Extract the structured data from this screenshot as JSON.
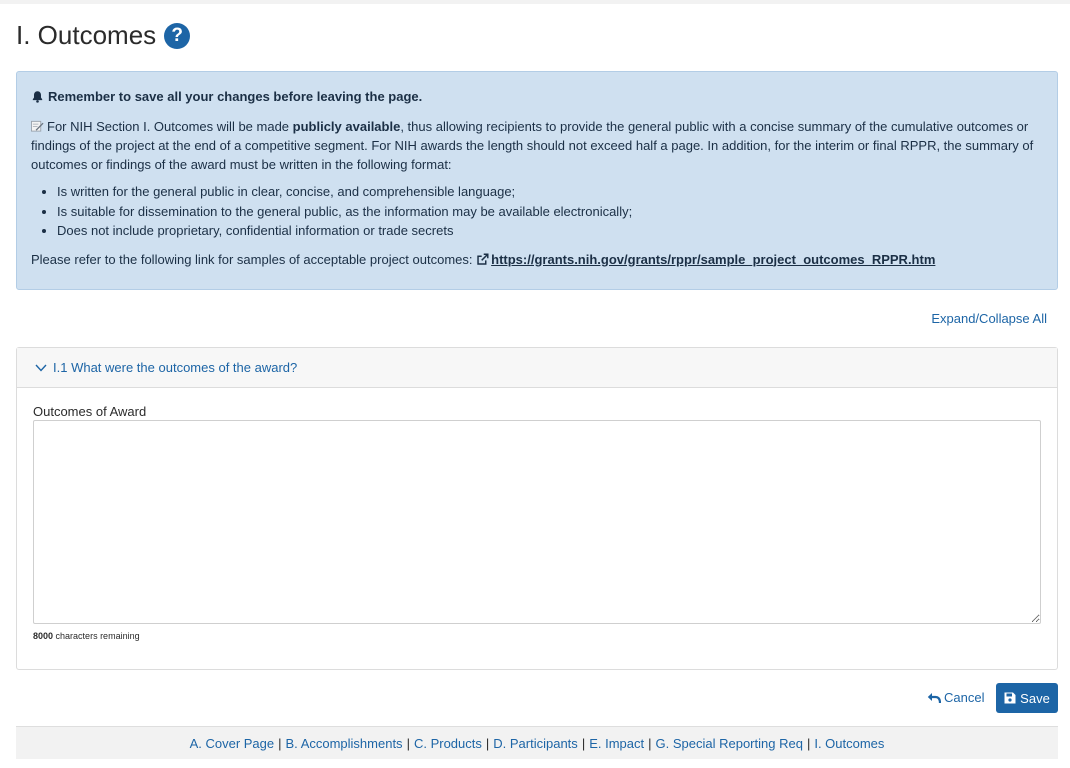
{
  "page": {
    "title": "I. Outcomes"
  },
  "alert": {
    "reminder": "Remember to save all your changes before leaving the page.",
    "para_part1": "For NIH Section I. Outcomes will be made ",
    "para_bold": "publicly available",
    "para_part2": ", thus allowing recipients to provide the general public with a concise summary of the cumulative outcomes or findings of the project at the end of a competitive segment. For NIH awards the length should not exceed half a page. In addition, for the interim or final RPPR, the summary of outcomes or findings of the award must be written in the following format:",
    "bullets": [
      "Is written for the general public in clear, concise, and comprehensible language;",
      "Is suitable for dissemination to the general public, as the information may be available electronically;",
      "Does not include proprietary, confidential information or trade secrets"
    ],
    "ref_text": "Please refer to the following link for samples of acceptable project outcomes:",
    "ref_link": "https://grants.nih.gov/grants/rppr/sample_project_outcomes_RPPR.htm"
  },
  "expand_collapse": "Expand/Collapse All",
  "section": {
    "header": "I.1 What were the outcomes of the award?",
    "field_label": "Outcomes of Award",
    "textarea_value": "",
    "chars_count": "8000",
    "chars_text": "characters remaining"
  },
  "actions": {
    "cancel": "Cancel",
    "save": "Save"
  },
  "footer_nav": [
    "A. Cover Page",
    "B. Accomplishments",
    "C. Products",
    "D. Participants",
    "E. Impact",
    "G. Special Reporting Req",
    "I. Outcomes"
  ],
  "footer_separator": "|",
  "colors": {
    "primary": "#1d65a6",
    "alert_bg": "#cfe0f0"
  }
}
